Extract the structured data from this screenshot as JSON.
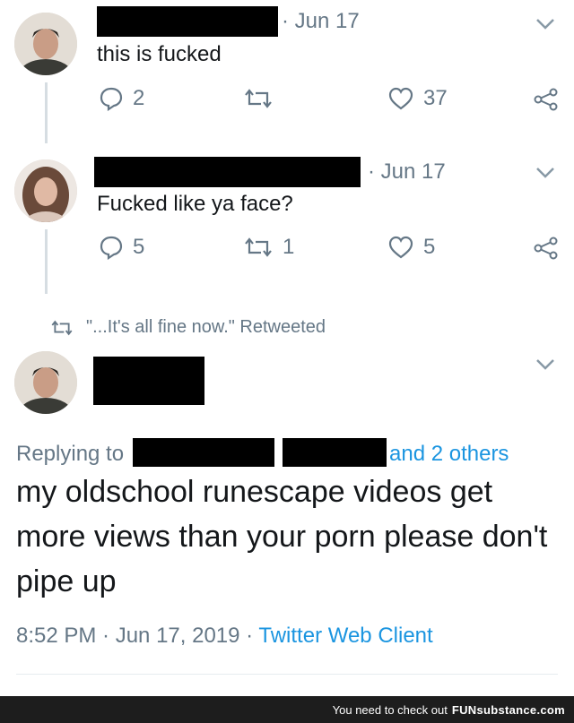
{
  "tweet1": {
    "date": "· Jun 17",
    "text": "this is fucked",
    "replies": "2",
    "retweets": "",
    "likes": "37"
  },
  "tweet2": {
    "date": "· Jun 17",
    "text": "Fucked like ya face?",
    "replies": "5",
    "retweets": "1",
    "likes": "5"
  },
  "retweet_notice": "\"...It's all fine now.\" Retweeted",
  "main_tweet": {
    "replying_prefix": "Replying to",
    "replying_suffix": "and 2 others",
    "text": "my oldschool runescape videos get more views than your porn please don't pipe up",
    "time": "8:52 PM · Jun 17, 2019 ·",
    "client": "Twitter Web Client"
  },
  "footer": {
    "text": "You need to check out",
    "brand": "FUNsubstance.com"
  },
  "colors": {
    "link": "#1b95e0",
    "muted": "#657786",
    "text": "#14171a"
  }
}
